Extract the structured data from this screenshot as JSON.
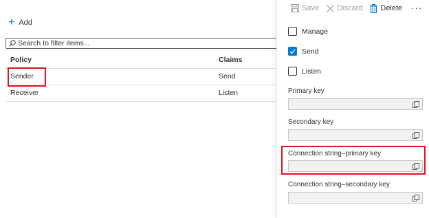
{
  "toolbar": {
    "add_label": "Add",
    "search_placeholder": "Search to filter items..."
  },
  "table": {
    "headers": [
      "Policy",
      "Claims"
    ],
    "rows": [
      {
        "policy": "Sender",
        "claims": "Send"
      },
      {
        "policy": "Receiver",
        "claims": "Listen"
      }
    ]
  },
  "panel": {
    "actions": {
      "save": "Save",
      "discard": "Discard",
      "delete": "Delete",
      "more": "···"
    },
    "claims": [
      {
        "label": "Manage",
        "checked": false
      },
      {
        "label": "Send",
        "checked": true
      },
      {
        "label": "Listen",
        "checked": false
      }
    ],
    "fields": [
      {
        "label": "Primary key",
        "value": ""
      },
      {
        "label": "Secondary key",
        "value": ""
      },
      {
        "label": "Connection string–primary key",
        "value": ""
      },
      {
        "label": "Connection string–secondary key",
        "value": ""
      }
    ]
  },
  "colors": {
    "accent": "#0078d4",
    "highlight": "#e0111b"
  }
}
